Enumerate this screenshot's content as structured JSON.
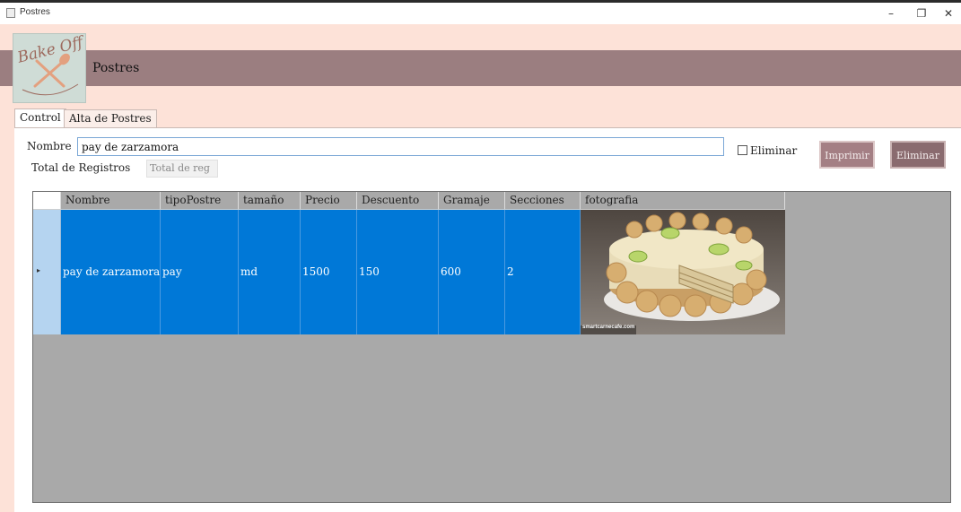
{
  "window": {
    "title": "Postres",
    "minimize_glyph": "–",
    "restore_glyph": "❐",
    "close_glyph": "✕",
    "icon": "window-app-icon"
  },
  "header": {
    "logo_text": "Bake Off",
    "title": "Postres"
  },
  "tabs": [
    {
      "label": "Control",
      "active": true
    },
    {
      "label": "Alta de Postres",
      "active": false
    }
  ],
  "form": {
    "nombre_label": "Nombre",
    "nombre_value": "pay de zarzamora",
    "eliminar_checkbox_label": "Eliminar",
    "eliminar_checked": false,
    "total_label": "Total de Registros",
    "total_value": "Total de reg",
    "print_button": "Imprimir",
    "delete_button": "Eliminar"
  },
  "grid": {
    "columns": [
      "Nombre",
      "tipoPostre",
      "tamaño",
      "Precio",
      "Descuento",
      "Gramaje",
      "Secciones",
      "fotografia"
    ],
    "rows": [
      {
        "Nombre": "pay de zarzamora",
        "tipoPostre": "pay",
        "tamano": "md",
        "Precio": "1500",
        "Descuento": "150",
        "Gramaje": "600",
        "Secciones": "2",
        "fotografia_caption": "smartcarnecafe.com",
        "selected": true
      }
    ],
    "row_indicator_glyph": "▸"
  },
  "colors": {
    "header_bg": "#fde2d8",
    "banner": "#9b7e80",
    "selection": "#0078d7",
    "grid_bg": "#a9a9a9",
    "print_button": "#a47f84",
    "delete_button": "#8a6b6f"
  }
}
